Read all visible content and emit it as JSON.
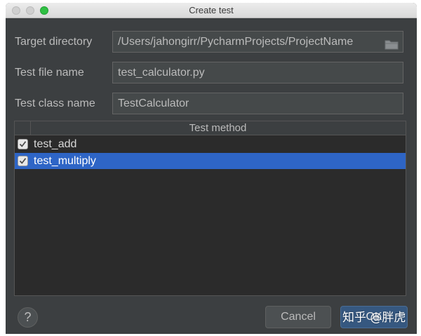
{
  "window": {
    "title": "Create test"
  },
  "form": {
    "target_directory": {
      "label": "Target directory",
      "value": "/Users/jahongirr/PycharmProjects/ProjectName"
    },
    "test_file_name": {
      "label": "Test file name",
      "value": "test_calculator.py"
    },
    "test_class_name": {
      "label": "Test class name",
      "value": "TestCalculator"
    }
  },
  "methods_table": {
    "column_header": "Test method",
    "rows": [
      {
        "label": "test_add",
        "checked": true,
        "selected": false
      },
      {
        "label": "test_multiply",
        "checked": true,
        "selected": true
      }
    ]
  },
  "footer": {
    "help_label": "?",
    "cancel_label": "Cancel",
    "ok_label": "OK"
  },
  "watermark": {
    "text": "知乎 @胖虎"
  },
  "colors": {
    "background": "#3c3f41",
    "selection": "#2e65c6",
    "primary_button": "#365880"
  },
  "icons": {
    "browse": "folder-icon",
    "check": "checkmark-icon"
  }
}
